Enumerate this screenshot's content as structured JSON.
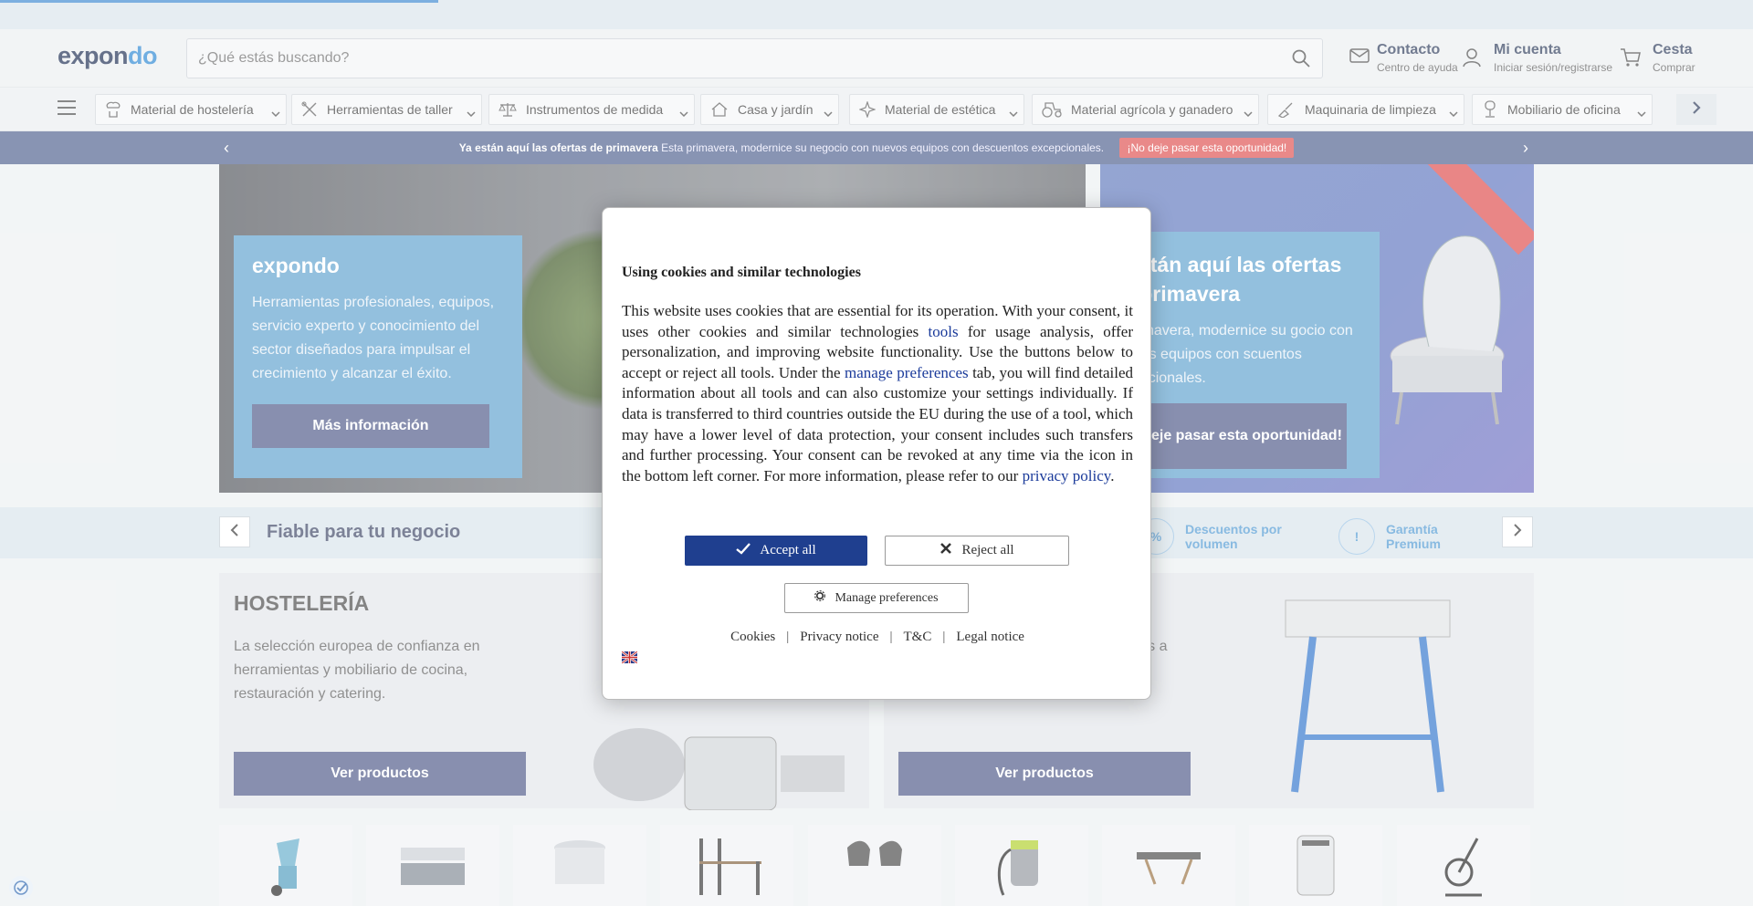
{
  "progress": {
    "value": 0.25
  },
  "header": {
    "logo_part1": "expon",
    "logo_part2": "do",
    "search_placeholder": "¿Qué estás buscando?",
    "contact": {
      "title": "Contacto",
      "subtitle": "Centro de ayuda"
    },
    "account": {
      "title": "Mi cuenta",
      "subtitle": "Iniciar sesión/registrarse"
    },
    "cart": {
      "title": "Cesta",
      "subtitle": "Comprar"
    }
  },
  "nav": {
    "items": [
      {
        "label": "Material de hostelería",
        "icon": "chef-icon"
      },
      {
        "label": "Herramientas de taller",
        "icon": "tools-icon"
      },
      {
        "label": "Instrumentos de medida",
        "icon": "scale-icon"
      },
      {
        "label": "Casa y jardín",
        "icon": "house-icon"
      },
      {
        "label": "Material de estética",
        "icon": "sparkle-icon"
      },
      {
        "label": "Material agrícola y ganadero",
        "icon": "tractor-icon"
      },
      {
        "label": "Maquinaria de limpieza",
        "icon": "cleaning-icon"
      },
      {
        "label": "Mobiliario de oficina",
        "icon": "chair-icon"
      }
    ]
  },
  "promo": {
    "bold": "Ya están aquí las ofertas de primavera",
    "text": "Esta primavera, modernice su negocio con nuevos equipos con descuentos excepcionales.",
    "cta": "¡No deje pasar esta oportunidad!",
    "prev": "‹",
    "next": "›"
  },
  "hero1": {
    "title": "expondo",
    "text": "Herramientas profesionales, equipos, servicio experto y conocimiento del sector diseñados para impulsar el crecimiento y alcanzar el éxito.",
    "button": "Más información"
  },
  "hero2": {
    "title": "a están aquí las ofertas de primavera",
    "text": "ta primavera, modernice su gocio con nuevos equipos con scuentos excepcionales.",
    "button": "¡No deje pasar esta oportunidad!"
  },
  "trust": {
    "title": "Fiable para tu negocio",
    "features": [
      {
        "label": "Descuentos por volumen"
      },
      {
        "label": "Garantía Premium"
      }
    ]
  },
  "categories": [
    {
      "title": "HOSTELERÍA",
      "text": "La selección europea de confianza en herramientas y mobiliario de cocina, restauración y catering.",
      "button": "Ver productos"
    },
    {
      "title": "",
      "text": "quipos a",
      "button": "Ver productos"
    }
  ],
  "cookie_modal": {
    "title": "Using cookies and similar technologies",
    "body_1": "This website uses cookies that are essential for its operation. With your consent, it uses other cookies and similar technologies ",
    "link_tools": "tools",
    "body_2": " for usage analysis, offer personalization, and improving website functionality. Use the buttons below to accept or reject all tools. Under the ",
    "link_manage": "manage preferences",
    "body_3": " tab, you will find detailed information about all tools and can also customize your settings individually. If data is transferred to third countries outside the EU during the use of a tool, which may have a lower level of data protection, your consent includes such transfers and further processing. Your consent can be revoked at any time via the icon in the bottom left corner. For more information, please refer to our ",
    "link_privacy": "privacy policy",
    "body_4": ".",
    "accept": "Accept all",
    "reject": "Reject all",
    "manage": "Manage preferences",
    "footer_links": [
      "Cookies",
      "Privacy notice",
      "T&C",
      "Legal notice"
    ],
    "separator": "|"
  },
  "colors": {
    "accent": "#3a8fd6",
    "brand_dark": "#2b3b5e",
    "promo_bg": "#5b6b96",
    "accept_bg": "#1f3f8f",
    "cta_red": "#e15c5c"
  }
}
